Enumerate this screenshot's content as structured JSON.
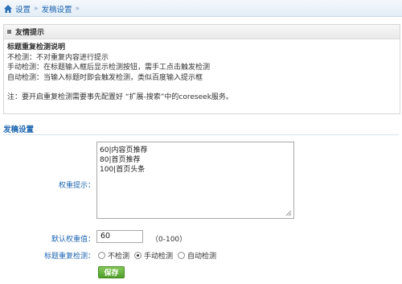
{
  "breadcrumb": {
    "items": [
      "设置",
      "发稿设置"
    ],
    "separator": "»"
  },
  "tip": {
    "header": "友情提示",
    "title": "标题重复检测说明",
    "lines": [
      "不检测：不对重复内容进行提示",
      "手动检测：在标题输入框后显示检测按钮，需手工点击触发检测",
      "自动检测：当输入标题时即会触发检测，类似百度输入提示框"
    ],
    "note": "注：要开启重复检测需要事先配置好 “扩展-搜索”中的coreseek服务。"
  },
  "section": {
    "title": "发稿设置"
  },
  "form": {
    "weight_label": "权重提示：",
    "weight_lines": [
      "60|内容页推荐",
      "80|首页推荐",
      "100|首页头条"
    ],
    "default_label": "默认权重值：",
    "default_value": "60",
    "range_hint": "（0-100）",
    "dup_label": "标题重复检测：",
    "dup_options": [
      "不检测",
      "手动检测",
      "自动检测"
    ],
    "dup_selected": "手动检测",
    "save_label": "保存"
  },
  "colors": {
    "link_blue": "#1f66b0",
    "save_green": "#4f9e2a"
  }
}
